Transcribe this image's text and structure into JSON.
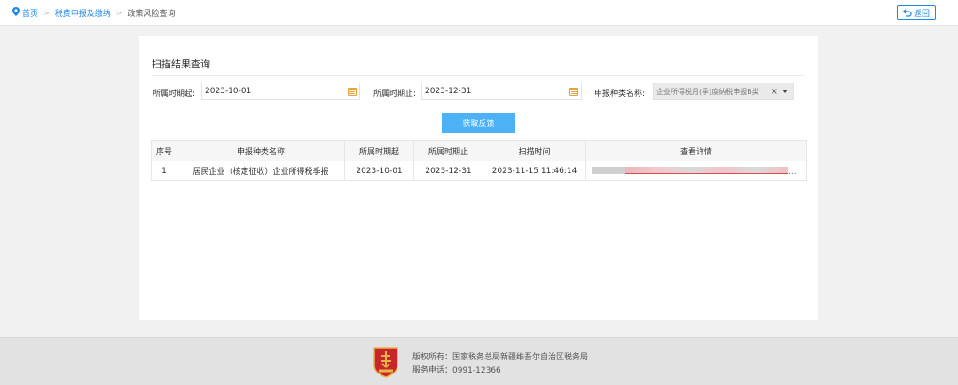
{
  "breadcrumb": {
    "home": "首页",
    "section": "税费申报及缴纳",
    "current": "政策风险查询",
    "separator": ">"
  },
  "back_button": {
    "label": "返回",
    "icon": "return-arrow-icon"
  },
  "card": {
    "title": "扫描结果查询"
  },
  "filters": {
    "start_label": "所属时期起:",
    "start_value": "2023-10-01",
    "end_label": "所属时期止:",
    "end_value": "2023-12-31",
    "type_label": "申报种类名称:",
    "type_value": "企业所得税月(季)度纳税申报B类",
    "clear_icon": "×",
    "calendar_icon": "calendar-icon"
  },
  "actions": {
    "fetch_label": "获取反馈"
  },
  "table": {
    "headers": [
      "序号",
      "申报种类名称",
      "所属时期起",
      "所属时期止",
      "扫描时间",
      "查看详情"
    ],
    "rows": [
      {
        "index": "1",
        "type_name": "居民企业（核定征收）企业所得税季报",
        "start": "2023-10-01",
        "end": "2023-12-31",
        "scan_time": "2023-11-15 11:46:14",
        "detail_ellipsis": "..."
      }
    ]
  },
  "footer": {
    "copyright": "版权所有：国家税务总局新疆维吾尔自治区税务局",
    "phone": "服务电话：0991-12366"
  },
  "colors": {
    "accent": "#1e88e5",
    "button": "#4db1f5",
    "calendar": "#e6a23c",
    "emblem_red": "#c8262b",
    "emblem_gold": "#e8b547"
  }
}
